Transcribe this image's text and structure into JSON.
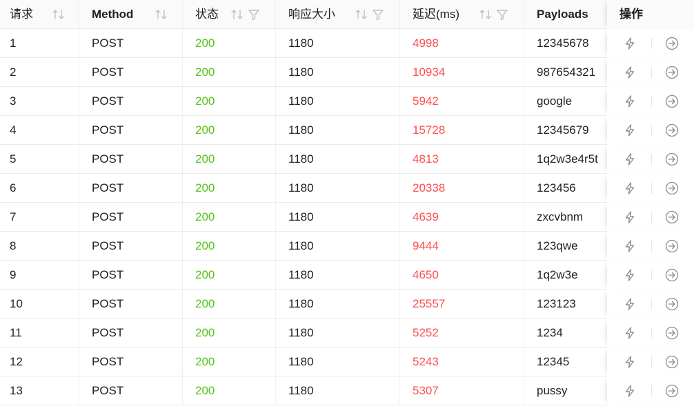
{
  "columns": {
    "request": "请求",
    "method": "Method",
    "status": "状态",
    "size": "响应大小",
    "latency": "延迟(ms)",
    "payloads": "Payloads",
    "actions": "操作"
  },
  "icons": {
    "sort": "sort-icon",
    "filter": "filter-icon",
    "run": "lightning-icon",
    "goto": "arrow-right-circle-icon"
  },
  "colors": {
    "status_ok": "#52c41a",
    "latency": "#ff4d4f",
    "header_bg": "#fafafa"
  },
  "rows": [
    {
      "id": "1",
      "method": "POST",
      "status": "200",
      "size": "1180",
      "latency": "4998",
      "payload": "12345678"
    },
    {
      "id": "2",
      "method": "POST",
      "status": "200",
      "size": "1180",
      "latency": "10934",
      "payload": "987654321"
    },
    {
      "id": "3",
      "method": "POST",
      "status": "200",
      "size": "1180",
      "latency": "5942",
      "payload": "google"
    },
    {
      "id": "4",
      "method": "POST",
      "status": "200",
      "size": "1180",
      "latency": "15728",
      "payload": "12345679"
    },
    {
      "id": "5",
      "method": "POST",
      "status": "200",
      "size": "1180",
      "latency": "4813",
      "payload": "1q2w3e4r5t"
    },
    {
      "id": "6",
      "method": "POST",
      "status": "200",
      "size": "1180",
      "latency": "20338",
      "payload": "123456"
    },
    {
      "id": "7",
      "method": "POST",
      "status": "200",
      "size": "1180",
      "latency": "4639",
      "payload": "zxcvbnm"
    },
    {
      "id": "8",
      "method": "POST",
      "status": "200",
      "size": "1180",
      "latency": "9444",
      "payload": "123qwe"
    },
    {
      "id": "9",
      "method": "POST",
      "status": "200",
      "size": "1180",
      "latency": "4650",
      "payload": "1q2w3e"
    },
    {
      "id": "10",
      "method": "POST",
      "status": "200",
      "size": "1180",
      "latency": "25557",
      "payload": "123123"
    },
    {
      "id": "11",
      "method": "POST",
      "status": "200",
      "size": "1180",
      "latency": "5252",
      "payload": "1234"
    },
    {
      "id": "12",
      "method": "POST",
      "status": "200",
      "size": "1180",
      "latency": "5243",
      "payload": "12345"
    },
    {
      "id": "13",
      "method": "POST",
      "status": "200",
      "size": "1180",
      "latency": "5307",
      "payload": "pussy"
    }
  ]
}
